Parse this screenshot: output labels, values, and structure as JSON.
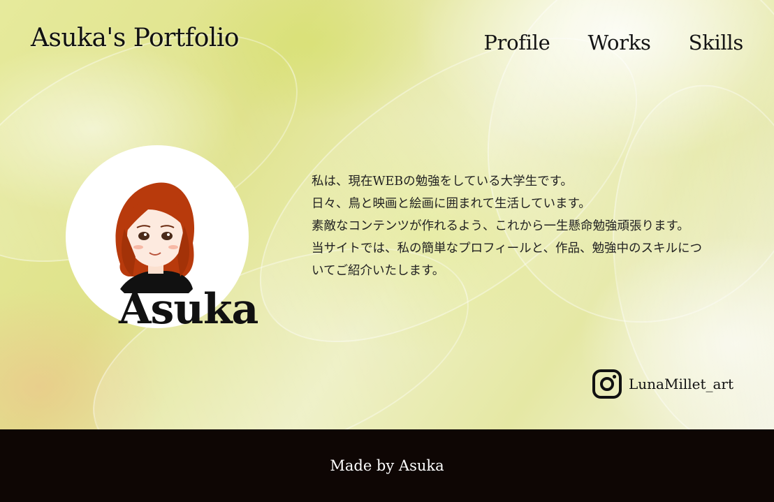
{
  "header": {
    "site_title": "Asuka's Portfolio",
    "nav": [
      {
        "label": "Profile"
      },
      {
        "label": "Works"
      },
      {
        "label": "Skills"
      }
    ]
  },
  "profile": {
    "name": "Asuka",
    "avatar_icon": "illustrated-portrait-icon",
    "intro_lines": [
      "私は、現在WEBの勉強をしている大学生です。",
      "日々、鳥と映画と絵画に囲まれて生活しています。",
      "素敵なコンテンツが作れるよう、これから一生懸命勉強頑張ります。",
      "当サイトでは、私の簡単なプロフィールと、作品、勉強中のスキルについてご紹介いたします。"
    ]
  },
  "social": {
    "icon": "instagram-icon",
    "handle": "LunaMillet_art"
  },
  "footer": {
    "text": "Made by Asuka"
  },
  "colors": {
    "footer_bg": "#0e0604",
    "hair": "#b83a0c",
    "text": "#111111"
  }
}
